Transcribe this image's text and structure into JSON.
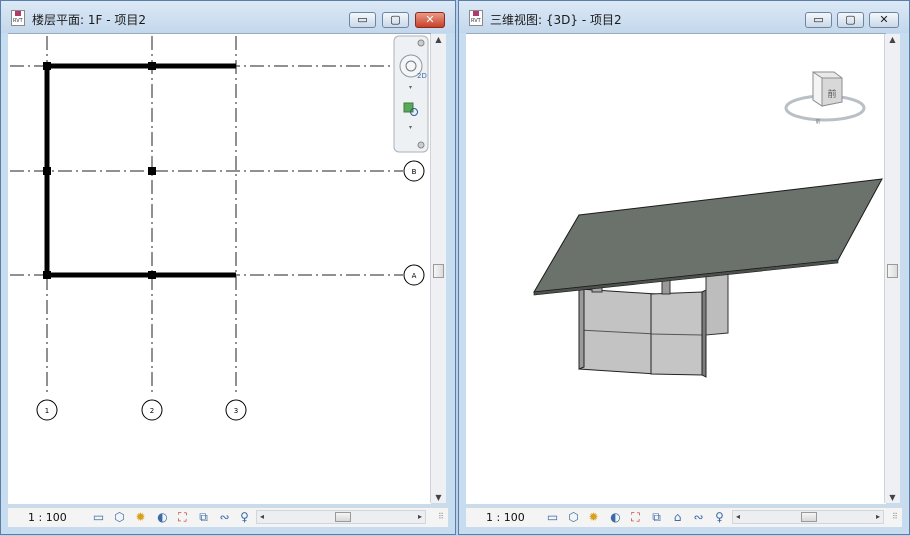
{
  "windows": [
    {
      "title": "楼层平面: 1F - 项目2",
      "app_icon_label": "RVT",
      "scale": "1 : 100",
      "grid_labels": {
        "col1": "1",
        "col2": "2",
        "col3": "3",
        "rowA": "A",
        "rowB": "B"
      },
      "nav_2d_label": "2D"
    },
    {
      "title": "三维视图: {3D} - 项目2",
      "app_icon_label": "RVT",
      "scale": "1 : 100",
      "viewcube_front": "前",
      "viewcube_face": "前"
    }
  ],
  "controls": {
    "minimize": "▭",
    "maximize": "▢",
    "close": "✕"
  },
  "status_icons": [
    "detail-level-icon",
    "visual-style-icon",
    "sun-path-icon",
    "shadows-icon",
    "crop-view-icon",
    "show-crop-icon",
    "temporary-hide-icon",
    "reveal-hidden-icon",
    "constraints-icon"
  ],
  "colors": {
    "roof": "#6b716b",
    "wall_light": "#c9c9c9",
    "wall_dark": "#9a9a9a",
    "plan_wall": "#000000"
  }
}
